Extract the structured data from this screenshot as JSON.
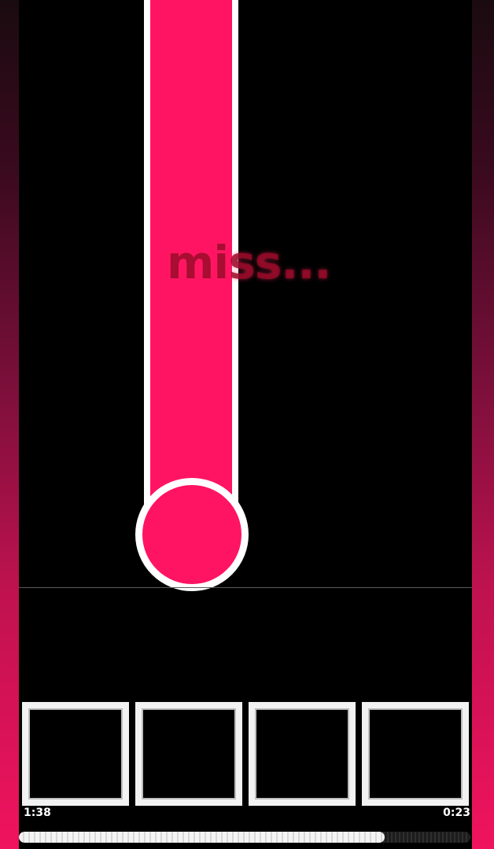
{
  "game": {
    "judgement_text": "miss...",
    "elapsed_time": "1:38",
    "remaining_time": "0:23",
    "progress_fraction": 0.81,
    "lane_count": 4
  },
  "colors": {
    "note_fill": "#ff1464",
    "note_outline": "#ffffff",
    "side_gradient_bottom": "#f0135e",
    "miss_text": "#960a28"
  },
  "keys": [
    {
      "lane": 1
    },
    {
      "lane": 2
    },
    {
      "lane": 3
    },
    {
      "lane": 4
    }
  ]
}
